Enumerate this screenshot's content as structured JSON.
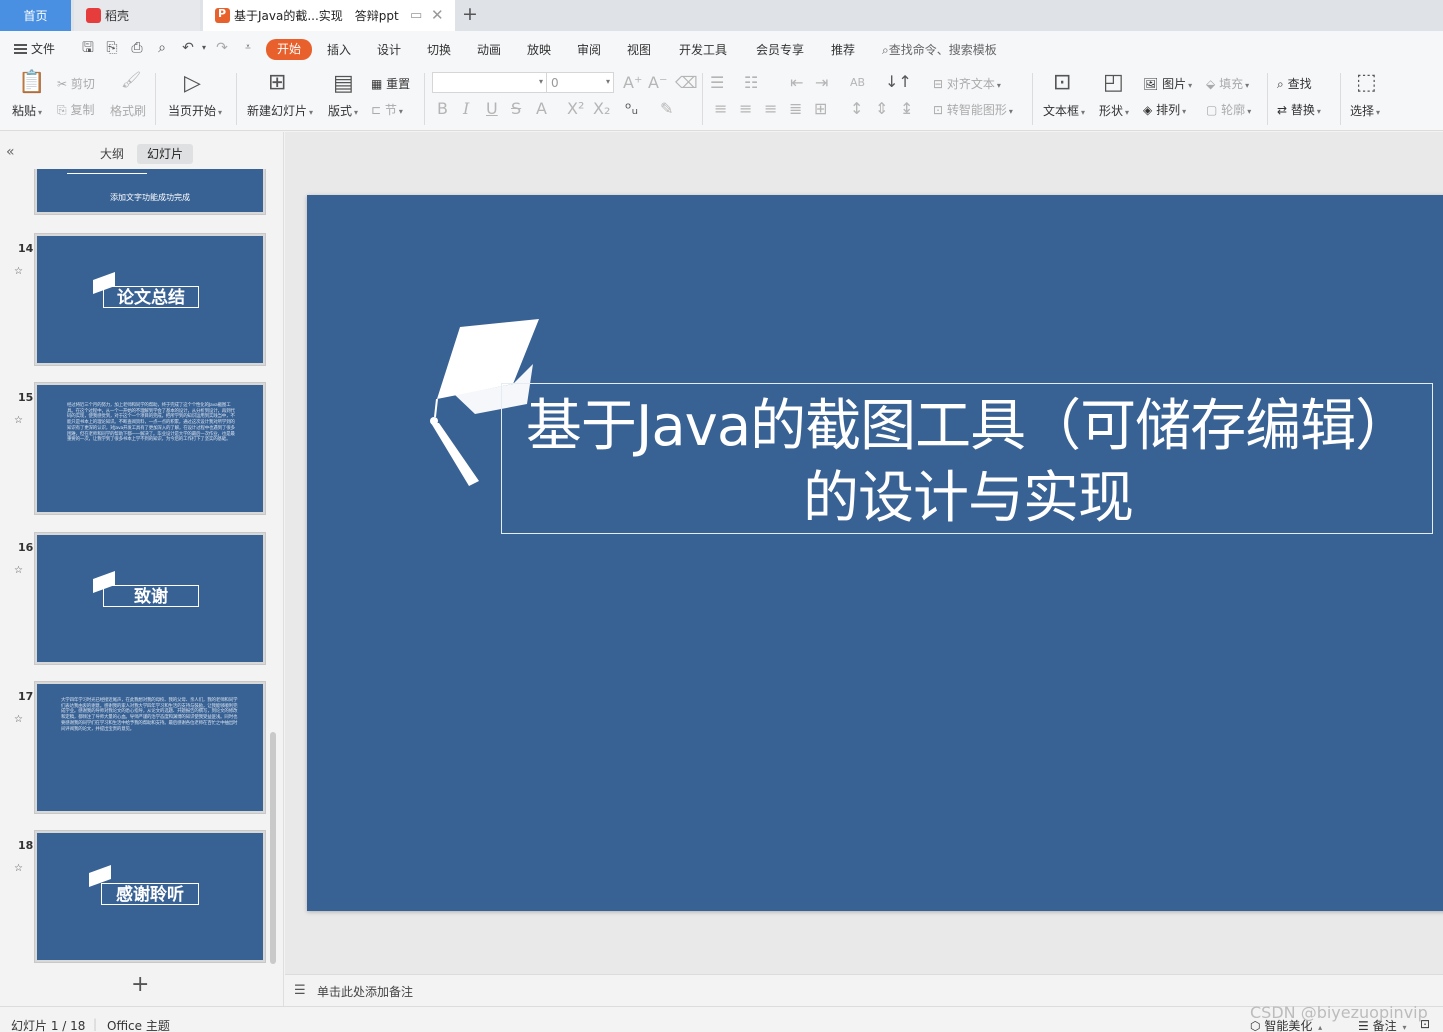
{
  "tabs": {
    "home": "首页",
    "docer": "稻壳",
    "document": "基于Java的截...实现　答辩ppt"
  },
  "menu": {
    "file": "文件",
    "items": [
      "开始",
      "插入",
      "设计",
      "切换",
      "动画",
      "放映",
      "审阅",
      "视图",
      "开发工具",
      "会员专享",
      "推荐"
    ],
    "search": "查找命令、搜索模板"
  },
  "ribbon": {
    "paste": "粘贴",
    "cut": "剪切",
    "copy": "复制",
    "format_painter": "格式刷",
    "from_start": "当页开始",
    "new_slide": "新建幻灯片",
    "layout": "版式",
    "reset": "重置",
    "section": "节",
    "font_size": "0",
    "align_text": "对齐文本",
    "smart_art": "转智能图形",
    "textbox": "文本框",
    "shape": "形状",
    "picture": "图片",
    "arrange": "排列",
    "fill": "填充",
    "outline": "轮廓",
    "find": "查找",
    "replace": "替换",
    "select": "选择"
  },
  "panel": {
    "outline_tab": "大纲",
    "slides_tab": "幻灯片",
    "partial_caption": "添加文字功能成功完成",
    "slides": [
      {
        "num": "14",
        "title": "论文总结"
      },
      {
        "num": "15",
        "text": "经过将近三个月的努力，加上老师和同学的帮助，终于完成了这个个性化的Java截图工具。在这个过程中，从一个一开始的不理解到学会了基本的设计，从分析到设计，再到代码的实现，使我感觉到，对于这个一个项目的完成，把所学到的知识运用到实践当中，不能只是书本上的理论知识。不断查阅资料，一点一点的积累，通过这次设计我对所学到的知识有了更深的认识，对Java开发工具有了更加深入的了解，在设计过程中也遇到了很多困难，但在老师和同学的帮助下都一一解决了。毕业设计是大学的最后一次作业，也是最重要的一次，让我学到了很多书本上学不到的知识，为今后的工作打下了坚实的基础。"
      },
      {
        "num": "16",
        "title": "致谢"
      },
      {
        "num": "17",
        "text": "大学四年学习时光已经接近尾声，在此我想对我的母校、我的父母、亲人们，我的老师和同学们表达我由衷的谢意。感谢我的家人对我大学四年学习和生活的支持与鼓励，让我能够顺利完成学业。感谢我的导师对我论文的悉心指导，从论文的选题、开题报告的撰写，到论文的修改和定稿，都倾注了导师大量的心血。导师严谨的治学态度和渊博的知识使我受益匪浅。同时也要感谢我的同学们在学习和生活中给予我的帮助和支持。最后感谢各位老师在百忙之中抽出时间评阅我的论文，并提出宝贵的意见。"
      },
      {
        "num": "18",
        "title": "感谢聆听"
      }
    ]
  },
  "slide": {
    "title_line1": "基于Java的截图工具（可储存编辑）",
    "title_line2": "的设计与实现"
  },
  "notes": {
    "placeholder": "单击此处添加备注"
  },
  "status": {
    "slide_counter": "幻灯片 1 / 18",
    "theme": "Office 主题",
    "beautify": "智能美化",
    "notes_toggle": "备注",
    "watermark": "CSDN @biyezuopinvip"
  }
}
